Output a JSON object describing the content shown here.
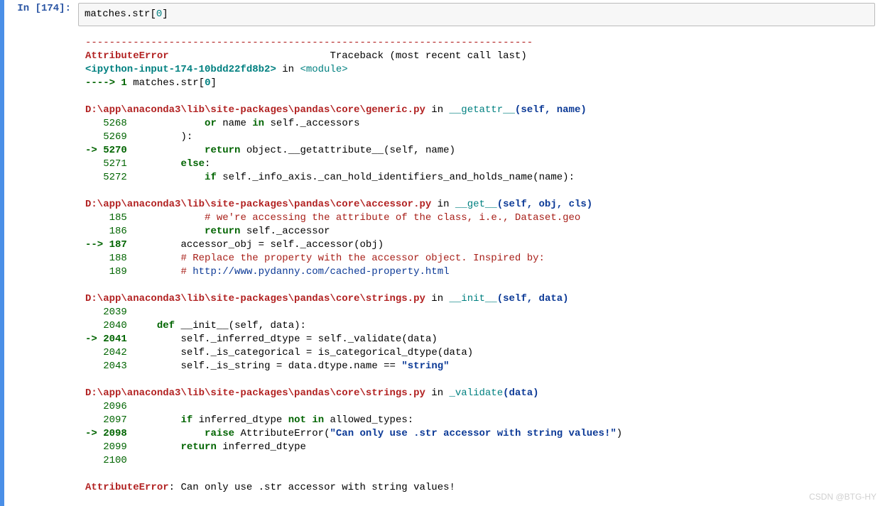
{
  "prompt": {
    "kind": "In ",
    "num": "[174]:"
  },
  "input_code": {
    "var": "matches",
    "dot": ".",
    "attr": "str",
    "lb": "[",
    "idx": "0",
    "rb": "]"
  },
  "dash_line": "---------------------------------------------------------------------------",
  "err_header": {
    "name": "AttributeError",
    "pad": "                           ",
    "trace": "Traceback (most recent call last)"
  },
  "src_line": {
    "a": "<ipython-input-174-10bdd22fd8b2>",
    "b": " in ",
    "c": "<module>"
  },
  "arrow_line": {
    "arrow": "---->",
    "num": " 1",
    "sp": " ",
    "var": "matches",
    "d1": ".",
    "attr": "str",
    "lb": "[",
    "idx": "0",
    "rb": "]"
  },
  "frame1": {
    "header": {
      "path": "D:\\app\\anaconda3\\lib\\site-packages\\pandas\\core\\generic.py",
      "in": " in ",
      "fn": "__getattr__",
      "args_open": "(",
      "arg1": "self",
      "comma": ", ",
      "arg2": "name",
      "args_close": ")"
    },
    "l5268": {
      "no": "   5268 ",
      "pad": "            ",
      "kw1": "or",
      "sp1": " ",
      "v1": "name",
      "sp2": " ",
      "kw2": "in",
      "sp3": " ",
      "v2": "self",
      "d": ".",
      "attr": "_accessors"
    },
    "l5269": {
      "no": "   5269 ",
      "pad": "        ",
      "paren": ")",
      "colon": ":"
    },
    "l5270": {
      "arrow": "-> 5270 ",
      "pad": "            ",
      "kw1": "return",
      "sp1": " ",
      "v1": "object",
      "d1": ".",
      "fn": "__getattribute__",
      "lp": "(",
      "a1": "self",
      "c": ",",
      "sp2": " ",
      "a2": "name",
      "rp": ")"
    },
    "l5271": {
      "no": "   5271 ",
      "pad": "        ",
      "kw": "else",
      "colon": ":"
    },
    "l5272": {
      "no": "   5272 ",
      "pad": "            ",
      "kw": "if",
      "sp": " ",
      "v": "self",
      "d": ".",
      "a1": "_info_axis",
      "d2": ".",
      "fn": "_can_hold_identifiers_and_holds_name",
      "lp": "(",
      "arg": "name",
      "rp": ")",
      "colon": ":"
    }
  },
  "frame2": {
    "header": {
      "path": "D:\\app\\anaconda3\\lib\\site-packages\\pandas\\core\\accessor.py",
      "in": " in ",
      "fn": "__get__",
      "args_open": "(",
      "a1": "self",
      "c1": ", ",
      "a2": "obj",
      "c2": ", ",
      "a3": "cls",
      "args_close": ")"
    },
    "l185": {
      "no": "    185 ",
      "pad": "            ",
      "comment": "# we're accessing the attribute of the class, i.e., Dataset.geo"
    },
    "l186": {
      "no": "    186 ",
      "pad": "            ",
      "kw": "return",
      "sp": " ",
      "v": "self",
      "d": ".",
      "attr": "_accessor"
    },
    "l187": {
      "arrow": "--> 187 ",
      "pad": "        ",
      "v1": "accessor_obj",
      "sp1": " ",
      "eq": "=",
      "sp2": " ",
      "v2": "self",
      "d": ".",
      "fn": "_accessor",
      "lp": "(",
      "arg": "obj",
      "rp": ")"
    },
    "l188": {
      "no": "    188 ",
      "pad": "        ",
      "comment": "# Replace the property with the accessor object. Inspired by:"
    },
    "l189": {
      "no": "    189 ",
      "pad": "        ",
      "hash": "# ",
      "url": "http://www.pydanny.com/cached-property.html"
    }
  },
  "frame3": {
    "header": {
      "path": "D:\\app\\anaconda3\\lib\\site-packages\\pandas\\core\\strings.py",
      "in": " in ",
      "fn": "__init__",
      "args_open": "(",
      "a1": "self",
      "c1": ", ",
      "a2": "data",
      "args_close": ")"
    },
    "l2039": {
      "no": "   2039 "
    },
    "l2040": {
      "no": "   2040 ",
      "pad": "    ",
      "kw": "def",
      "sp": " ",
      "fn": "__init__",
      "lp": "(",
      "a1": "self",
      "c": ",",
      "sp2": " ",
      "a2": "data",
      "rp": ")",
      "colon": ":"
    },
    "l2041": {
      "arrow": "-> 2041 ",
      "pad": "        ",
      "v1": "self",
      "d1": ".",
      "a1": "_inferred_dtype",
      "sp1": " ",
      "eq": "=",
      "sp2": " ",
      "v2": "self",
      "d2": ".",
      "fn": "_validate",
      "lp": "(",
      "arg": "data",
      "rp": ")"
    },
    "l2042": {
      "no": "   2042 ",
      "pad": "        ",
      "v1": "self",
      "d1": ".",
      "a1": "_is_categorical",
      "sp1": " ",
      "eq": "=",
      "sp2": " ",
      "fn": "is_categorical_dtype",
      "lp": "(",
      "arg": "data",
      "rp": ")"
    },
    "l2043": {
      "no": "   2043 ",
      "pad": "        ",
      "v1": "self",
      "d1": ".",
      "a1": "_is_string",
      "sp1": " ",
      "eq": "=",
      "sp2": " ",
      "v2": "data",
      "d2": ".",
      "a2": "dtype",
      "d3": ".",
      "a3": "name",
      "sp3": " ",
      "eqeq": "==",
      "sp4": " ",
      "str": "\"string\""
    }
  },
  "frame4": {
    "header": {
      "path": "D:\\app\\anaconda3\\lib\\site-packages\\pandas\\core\\strings.py",
      "in": " in ",
      "fn": "_validate",
      "args_open": "(",
      "a1": "data",
      "args_close": ")"
    },
    "l2096": {
      "no": "   2096 "
    },
    "l2097": {
      "no": "   2097 ",
      "pad": "        ",
      "kw": "if",
      "sp": " ",
      "v1": "inferred_dtype",
      "sp2": " ",
      "kw2": "not",
      "sp3": " ",
      "kw3": "in",
      "sp4": " ",
      "v2": "allowed_types",
      "colon": ":"
    },
    "l2098": {
      "arrow": "-> 2098 ",
      "pad": "            ",
      "kw": "raise",
      "sp": " ",
      "err": "AttributeError",
      "lp": "(",
      "str": "\"Can only use .str accessor with string values!\"",
      "rp": ")"
    },
    "l2099": {
      "no": "   2099 ",
      "pad": "        ",
      "kw": "return",
      "sp": " ",
      "v": "inferred_dtype"
    },
    "l2100": {
      "no": "   2100 "
    }
  },
  "final_err": {
    "name": "AttributeError",
    "colon": ": ",
    "msg": "Can only use .str accessor with string values!"
  },
  "watermark": "CSDN @BTG-HY"
}
